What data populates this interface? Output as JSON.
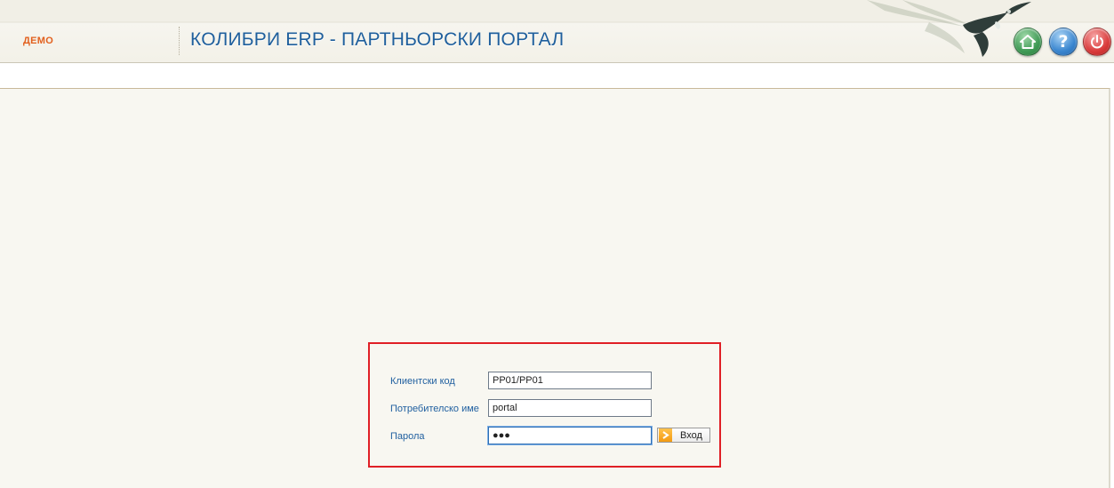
{
  "header": {
    "environment_label": "ДЕМО",
    "title": "КОЛИБРИ ERP - ПАРТНЬОРСКИ ПОРТАЛ",
    "buttons": [
      {
        "icon": "home-icon",
        "color": "#3f9a55"
      },
      {
        "icon": "help-icon",
        "color": "#3a86cf",
        "glyph": "?"
      },
      {
        "icon": "power-icon",
        "color": "#d93b3b"
      }
    ]
  },
  "login": {
    "client_code_label": "Клиентски код",
    "client_code_value": "PP01/PP01",
    "username_label": "Потребителско име",
    "username_value": "portal",
    "password_label": "Парола",
    "password_value": "●●●",
    "submit_label": "Вход",
    "highlight_color": "#e01f26"
  },
  "colors": {
    "title": "#1f5f9c",
    "label": "#2160a0",
    "environment_label": "#e2601e",
    "panel_background": "#f8f7f1"
  }
}
